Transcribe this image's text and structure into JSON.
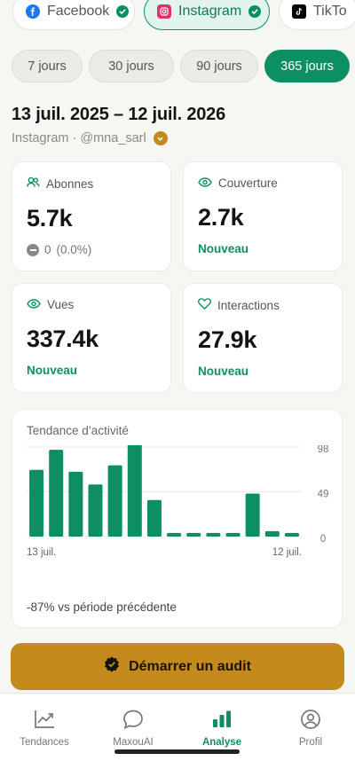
{
  "platforms": [
    {
      "label": "Facebook",
      "selected": false
    },
    {
      "label": "Instagram",
      "selected": true
    },
    {
      "label": "TikTo",
      "selected": false
    }
  ],
  "periods": [
    {
      "label": "7 jours",
      "active": false
    },
    {
      "label": "30 jours",
      "active": false
    },
    {
      "label": "90 jours",
      "active": false
    },
    {
      "label": "365 jours",
      "active": true
    }
  ],
  "date_range": "13 juil. 2025 – 12 juil. 2026",
  "account": {
    "label": "Instagram · @mna_sarl"
  },
  "stats": {
    "abonnes": {
      "label": "Abonnes",
      "value": "5.7k",
      "change": "0",
      "change_pct": "(0.0%)"
    },
    "couverture": {
      "label": "Couverture",
      "value": "2.7k",
      "note": "Nouveau"
    },
    "vues": {
      "label": "Vues",
      "value": "337.4k",
      "note": "Nouveau"
    },
    "interactions": {
      "label": "Interactions",
      "value": "27.9k",
      "note": "Nouveau"
    }
  },
  "activity": {
    "title": "Tendance d’activité",
    "comparison": "-87% vs période précédente"
  },
  "chart_data": {
    "type": "bar",
    "title": "Tendance d’activité",
    "x_start_label": "13 juil.",
    "x_end_label": "12 juil.",
    "y_ticks": [
      "98",
      "49",
      "0"
    ],
    "ylim": [
      0,
      98
    ],
    "values": [
      73,
      95,
      71,
      57,
      78,
      107,
      40,
      4,
      4,
      4,
      4,
      47,
      6,
      4
    ],
    "bar_color": "#0e8f63",
    "grid": true
  },
  "audit": {
    "label": "Démarrer un audit"
  },
  "nav": [
    {
      "label": "Tendances",
      "icon": "trend-icon",
      "active": false
    },
    {
      "label": "MaxouAI",
      "icon": "chat-bubble-icon",
      "active": false
    },
    {
      "label": "Analyse",
      "icon": "bar-chart-icon",
      "active": true
    },
    {
      "label": "Profil",
      "icon": "user-circle-icon",
      "active": false
    }
  ],
  "colors": {
    "accent": "#0e8f63",
    "gold": "#c48a1c"
  }
}
